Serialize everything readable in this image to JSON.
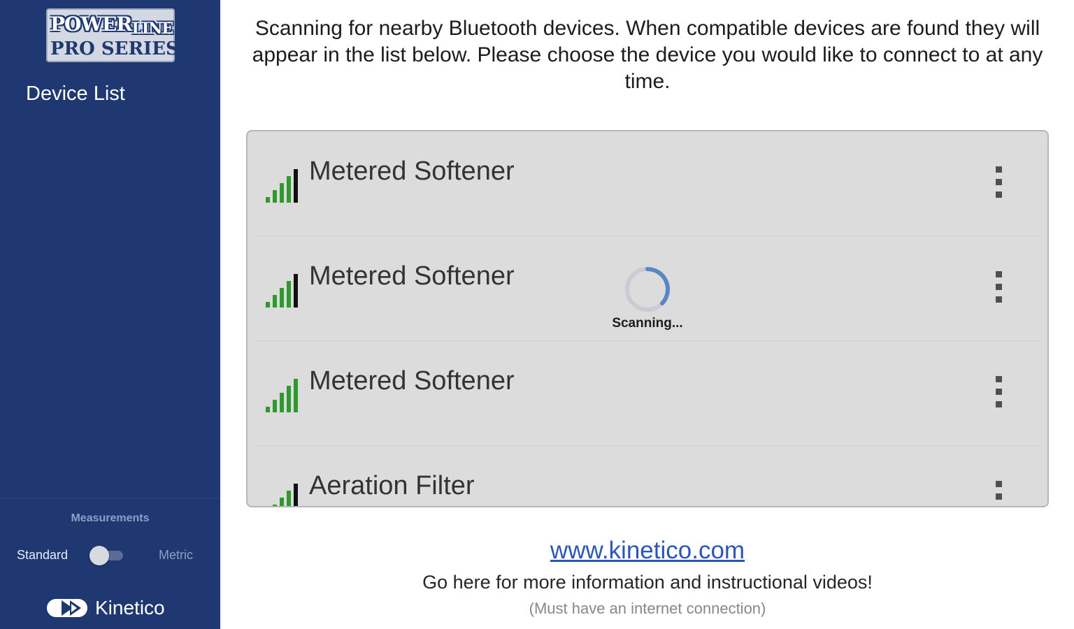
{
  "sidebar": {
    "logo": {
      "line1": "POWER",
      "line1b": "LINE",
      "line2": "PRO SERIES"
    },
    "title": "Device List",
    "measurements": {
      "label": "Measurements",
      "left_option": "Standard",
      "right_option": "Metric",
      "selected": "Standard"
    },
    "brand": {
      "name": "Kinetico",
      "icon": "kinetico-logo-icon"
    }
  },
  "main": {
    "intro": "Scanning for nearby Bluetooth devices. When compatible devices are found they will appear in the list below. Please choose the device you would like to connect to at any time.",
    "devices": [
      {
        "name": "Metered Softener",
        "signal_bars": 5,
        "icon": "signal-strength-icon",
        "menu_icon": "more-vert-icon"
      },
      {
        "name": "Metered Softener",
        "signal_bars": 5,
        "icon": "signal-strength-icon",
        "menu_icon": "more-vert-icon"
      },
      {
        "name": "Metered Softener",
        "signal_bars": 5,
        "icon": "signal-strength-icon",
        "menu_icon": "more-vert-icon"
      },
      {
        "name": "Aeration Filter",
        "signal_bars": 5,
        "icon": "signal-strength-icon",
        "menu_icon": "more-vert-icon"
      }
    ],
    "scanning": {
      "label": "Scanning...",
      "icon": "spinner-icon"
    },
    "footer": {
      "link": "www.kinetico.com",
      "info": "Go here for more information and instructional videos!",
      "note": "(Must have an internet connection)"
    }
  },
  "colors": {
    "sidebar_bg": "#1f3872",
    "signal_green": "#2e9a2e",
    "signal_dark": "#111111",
    "link": "#2b56b8",
    "panel_bg": "#dcdcdc"
  }
}
